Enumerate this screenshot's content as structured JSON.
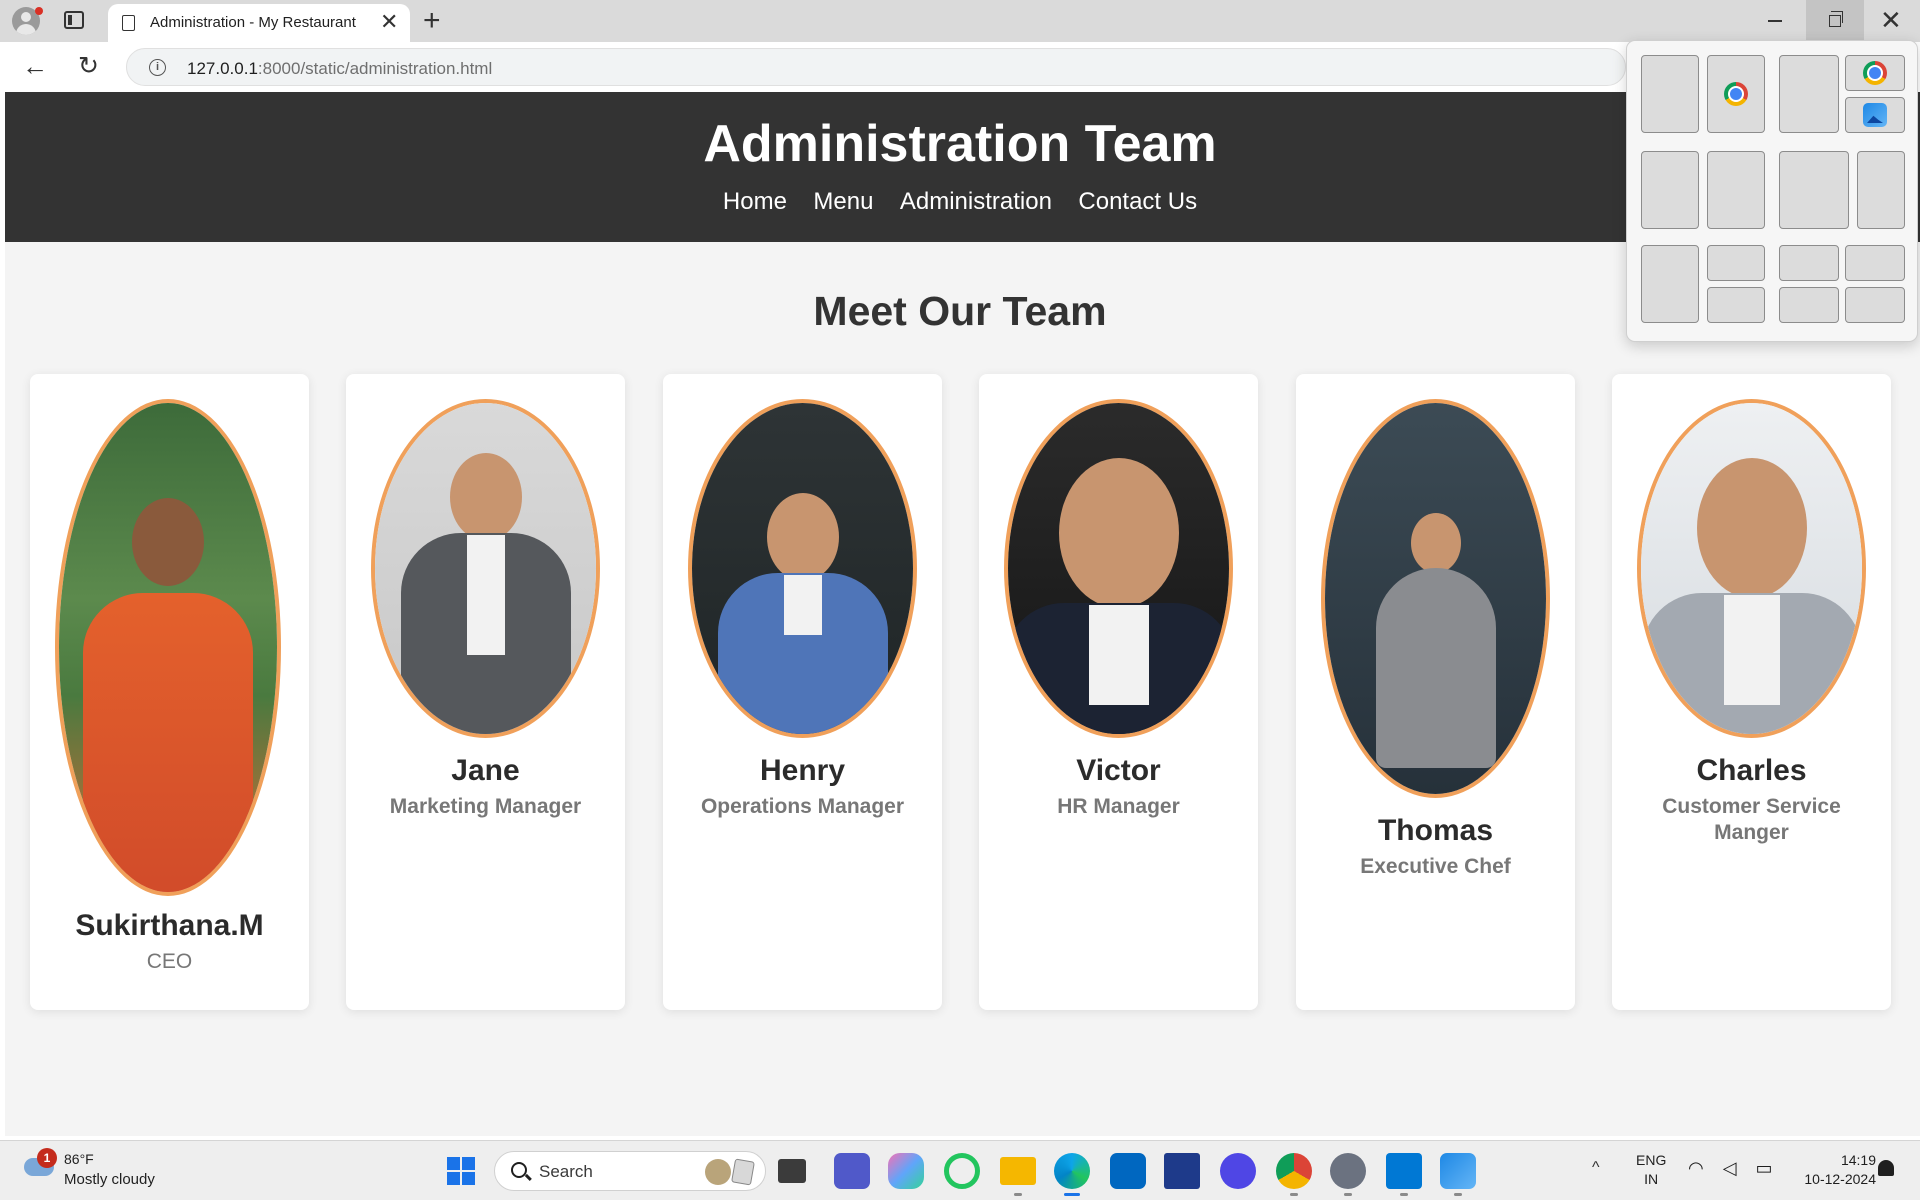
{
  "browser": {
    "tab_title": "Administration - My Restaurant",
    "new_tab_label": "+",
    "close_tab_label": "✕",
    "url_host": "127.0.0.1",
    "url_path": ":8000/static/administration.html",
    "back_label": "←",
    "reload_label": "↻",
    "close_window_label": "✕"
  },
  "site": {
    "title": "Administration Team",
    "nav": [
      "Home",
      "Menu",
      "Administration",
      "Contact Us"
    ],
    "section_title": "Meet Our Team",
    "accent_color": "#f0a05a",
    "header_color": "#333333"
  },
  "team": [
    {
      "name": "Sukirthana.M",
      "role": "CEO"
    },
    {
      "name": "Jane",
      "role": "Marketing Manager"
    },
    {
      "name": "Henry",
      "role": "Operations Manager"
    },
    {
      "name": "Victor",
      "role": "HR Manager"
    },
    {
      "name": "Thomas",
      "role": "Executive Chef"
    },
    {
      "name": "Charles",
      "role": "Customer Service Manger"
    }
  ],
  "taskbar": {
    "weather_temp": "86°F",
    "weather_desc": "Mostly cloudy",
    "weather_badge": "1",
    "search_placeholder": "Search",
    "language_line1": "ENG",
    "language_line2": "IN",
    "time": "14:19",
    "date": "10-12-2024",
    "tray_chevron": "^",
    "apps": [
      "task-view",
      "teams",
      "copilot",
      "refresh-app",
      "file-explorer",
      "edge",
      "store",
      "l-app",
      "ai-app",
      "chrome",
      "settings",
      "vscode",
      "photos"
    ]
  }
}
